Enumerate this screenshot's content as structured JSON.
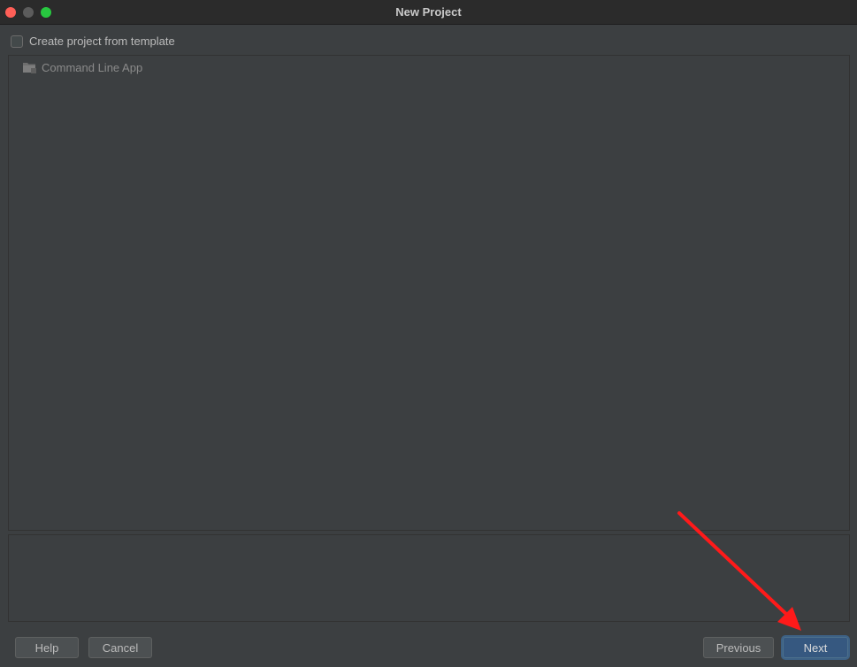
{
  "window": {
    "title": "New Project"
  },
  "options": {
    "create_from_template_label": "Create project from template",
    "create_from_template_checked": false
  },
  "templates": {
    "items": [
      {
        "label": "Command Line App",
        "icon": "folder-icon"
      }
    ]
  },
  "footer": {
    "help_label": "Help",
    "cancel_label": "Cancel",
    "previous_label": "Previous",
    "next_label": "Next"
  },
  "colors": {
    "background": "#3c3f41",
    "titlebar": "#2b2b2b",
    "primary_button": "#365880",
    "annotation_arrow": "#ff1a1a"
  }
}
